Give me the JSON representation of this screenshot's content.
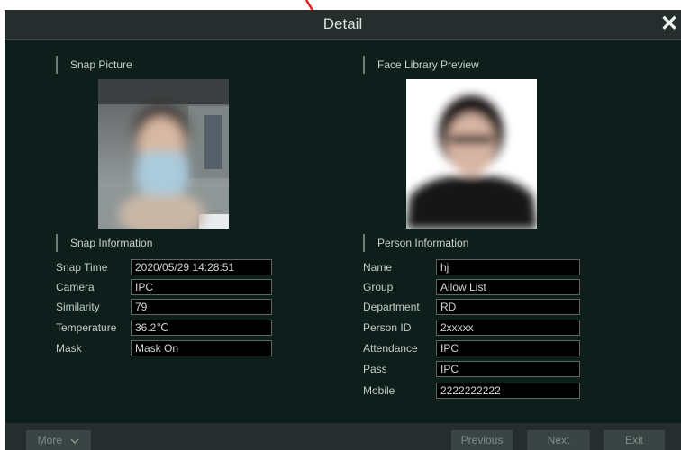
{
  "dialog": {
    "title": "Detail",
    "close_icon": "close-icon"
  },
  "snap_picture": {
    "heading": "Snap Picture"
  },
  "face_library": {
    "heading": "Face Library Preview"
  },
  "snap_info": {
    "heading": "Snap Information",
    "rows": [
      {
        "label": "Snap Time",
        "value": "2020/05/29 14:28:51"
      },
      {
        "label": "Camera",
        "value": "IPC"
      },
      {
        "label": "Similarity",
        "value": "79"
      },
      {
        "label": "Temperature",
        "value": "36.2℃"
      },
      {
        "label": "Mask",
        "value": "Mask On"
      }
    ]
  },
  "person_info": {
    "heading": "Person Information",
    "rows": [
      {
        "label": "Name",
        "value": "hj"
      },
      {
        "label": "Group",
        "value": "Allow List"
      },
      {
        "label": "Department",
        "value": "RD"
      },
      {
        "label": "Person ID",
        "value": "2xxxxx"
      },
      {
        "label": "Attendance",
        "value": "IPC"
      },
      {
        "label": "Pass",
        "value": "IPC"
      },
      {
        "label": "Mobile",
        "value": "2222222222"
      }
    ]
  },
  "footer": {
    "more_label": "More",
    "more_icon": "chevron-down-icon",
    "previous_label": "Previous",
    "next_label": "Next",
    "exit_label": "Exit"
  },
  "colors": {
    "background": "#0e1e1a",
    "bar": "#262e2d",
    "annotation_arrow": "#e02020"
  }
}
